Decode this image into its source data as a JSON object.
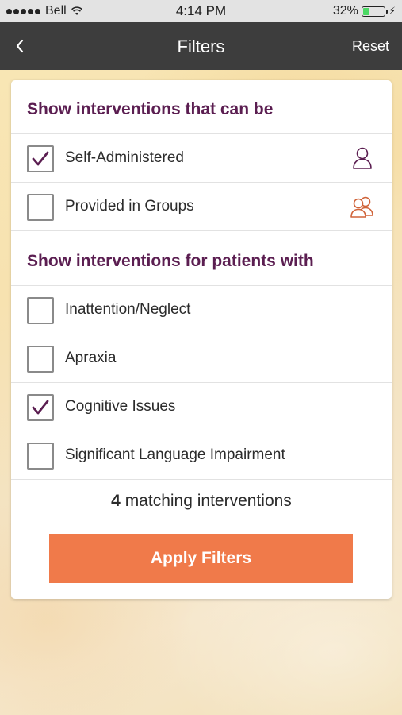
{
  "status_bar": {
    "carrier": "Bell",
    "time": "4:14 PM",
    "battery_percent": "32%",
    "battery_level": 0.32,
    "icons": [
      "signal-dots-icon",
      "wifi-icon",
      "battery-icon",
      "charging-bolt-icon"
    ]
  },
  "nav": {
    "back_icon": "chevron-left-icon",
    "title": "Filters",
    "reset_label": "Reset"
  },
  "sections": [
    {
      "heading": "Show interventions that can be",
      "options": [
        {
          "label": "Self-Administered",
          "checked": true,
          "icon": "person-icon"
        },
        {
          "label": "Provided in Groups",
          "checked": false,
          "icon": "group-icon"
        }
      ]
    },
    {
      "heading": "Show interventions for patients with",
      "options": [
        {
          "label": "Inattention/Neglect",
          "checked": false
        },
        {
          "label": "Apraxia",
          "checked": false
        },
        {
          "label": "Cognitive Issues",
          "checked": true
        },
        {
          "label": "Significant Language Impairment",
          "checked": false
        }
      ]
    }
  ],
  "results": {
    "count": "4",
    "suffix": " matching interventions"
  },
  "apply_label": "Apply Filters",
  "colors": {
    "heading": "#5b1e51",
    "checkmark": "#5b1e51",
    "person_icon": "#5b1e51",
    "group_icon": "#d0643a",
    "apply_button": "#f07a4a",
    "nav_bar": "#3d3d3d"
  }
}
